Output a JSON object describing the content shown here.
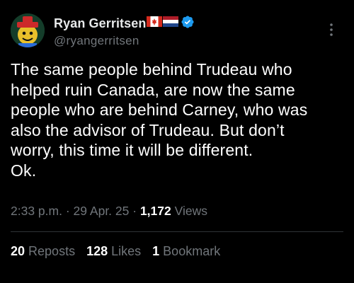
{
  "tweet": {
    "author": {
      "display_name": "Ryan Gerritsen",
      "handle": "@ryangerritsen",
      "flags": [
        "canada-flag-icon",
        "netherlands-flag-icon"
      ],
      "verified": true,
      "verified_color": "#1d9bf0"
    },
    "text_lines": [
      "The same people behind Trudeau who",
      "helped ruin Canada, are now the same",
      "people who are behind Carney, who was",
      "also the advisor of Trudeau. But don’t",
      "worry, this time it will be different.",
      "Ok."
    ],
    "meta": {
      "time": "2:33 p.m.",
      "separator": "·",
      "date": "29 Apr. 25",
      "views_count": "1,172",
      "views_label": "Views"
    },
    "stats": {
      "reposts_count": "20",
      "reposts_label": "Reposts",
      "likes_count": "128",
      "likes_label": "Likes",
      "bookmarks_count": "1",
      "bookmarks_label": "Bookmark"
    }
  },
  "colors": {
    "background": "#000000",
    "text_primary": "#e7e9ea",
    "text_secondary": "#71767b",
    "divider": "#2f3336",
    "verified_blue": "#1d9bf0"
  }
}
